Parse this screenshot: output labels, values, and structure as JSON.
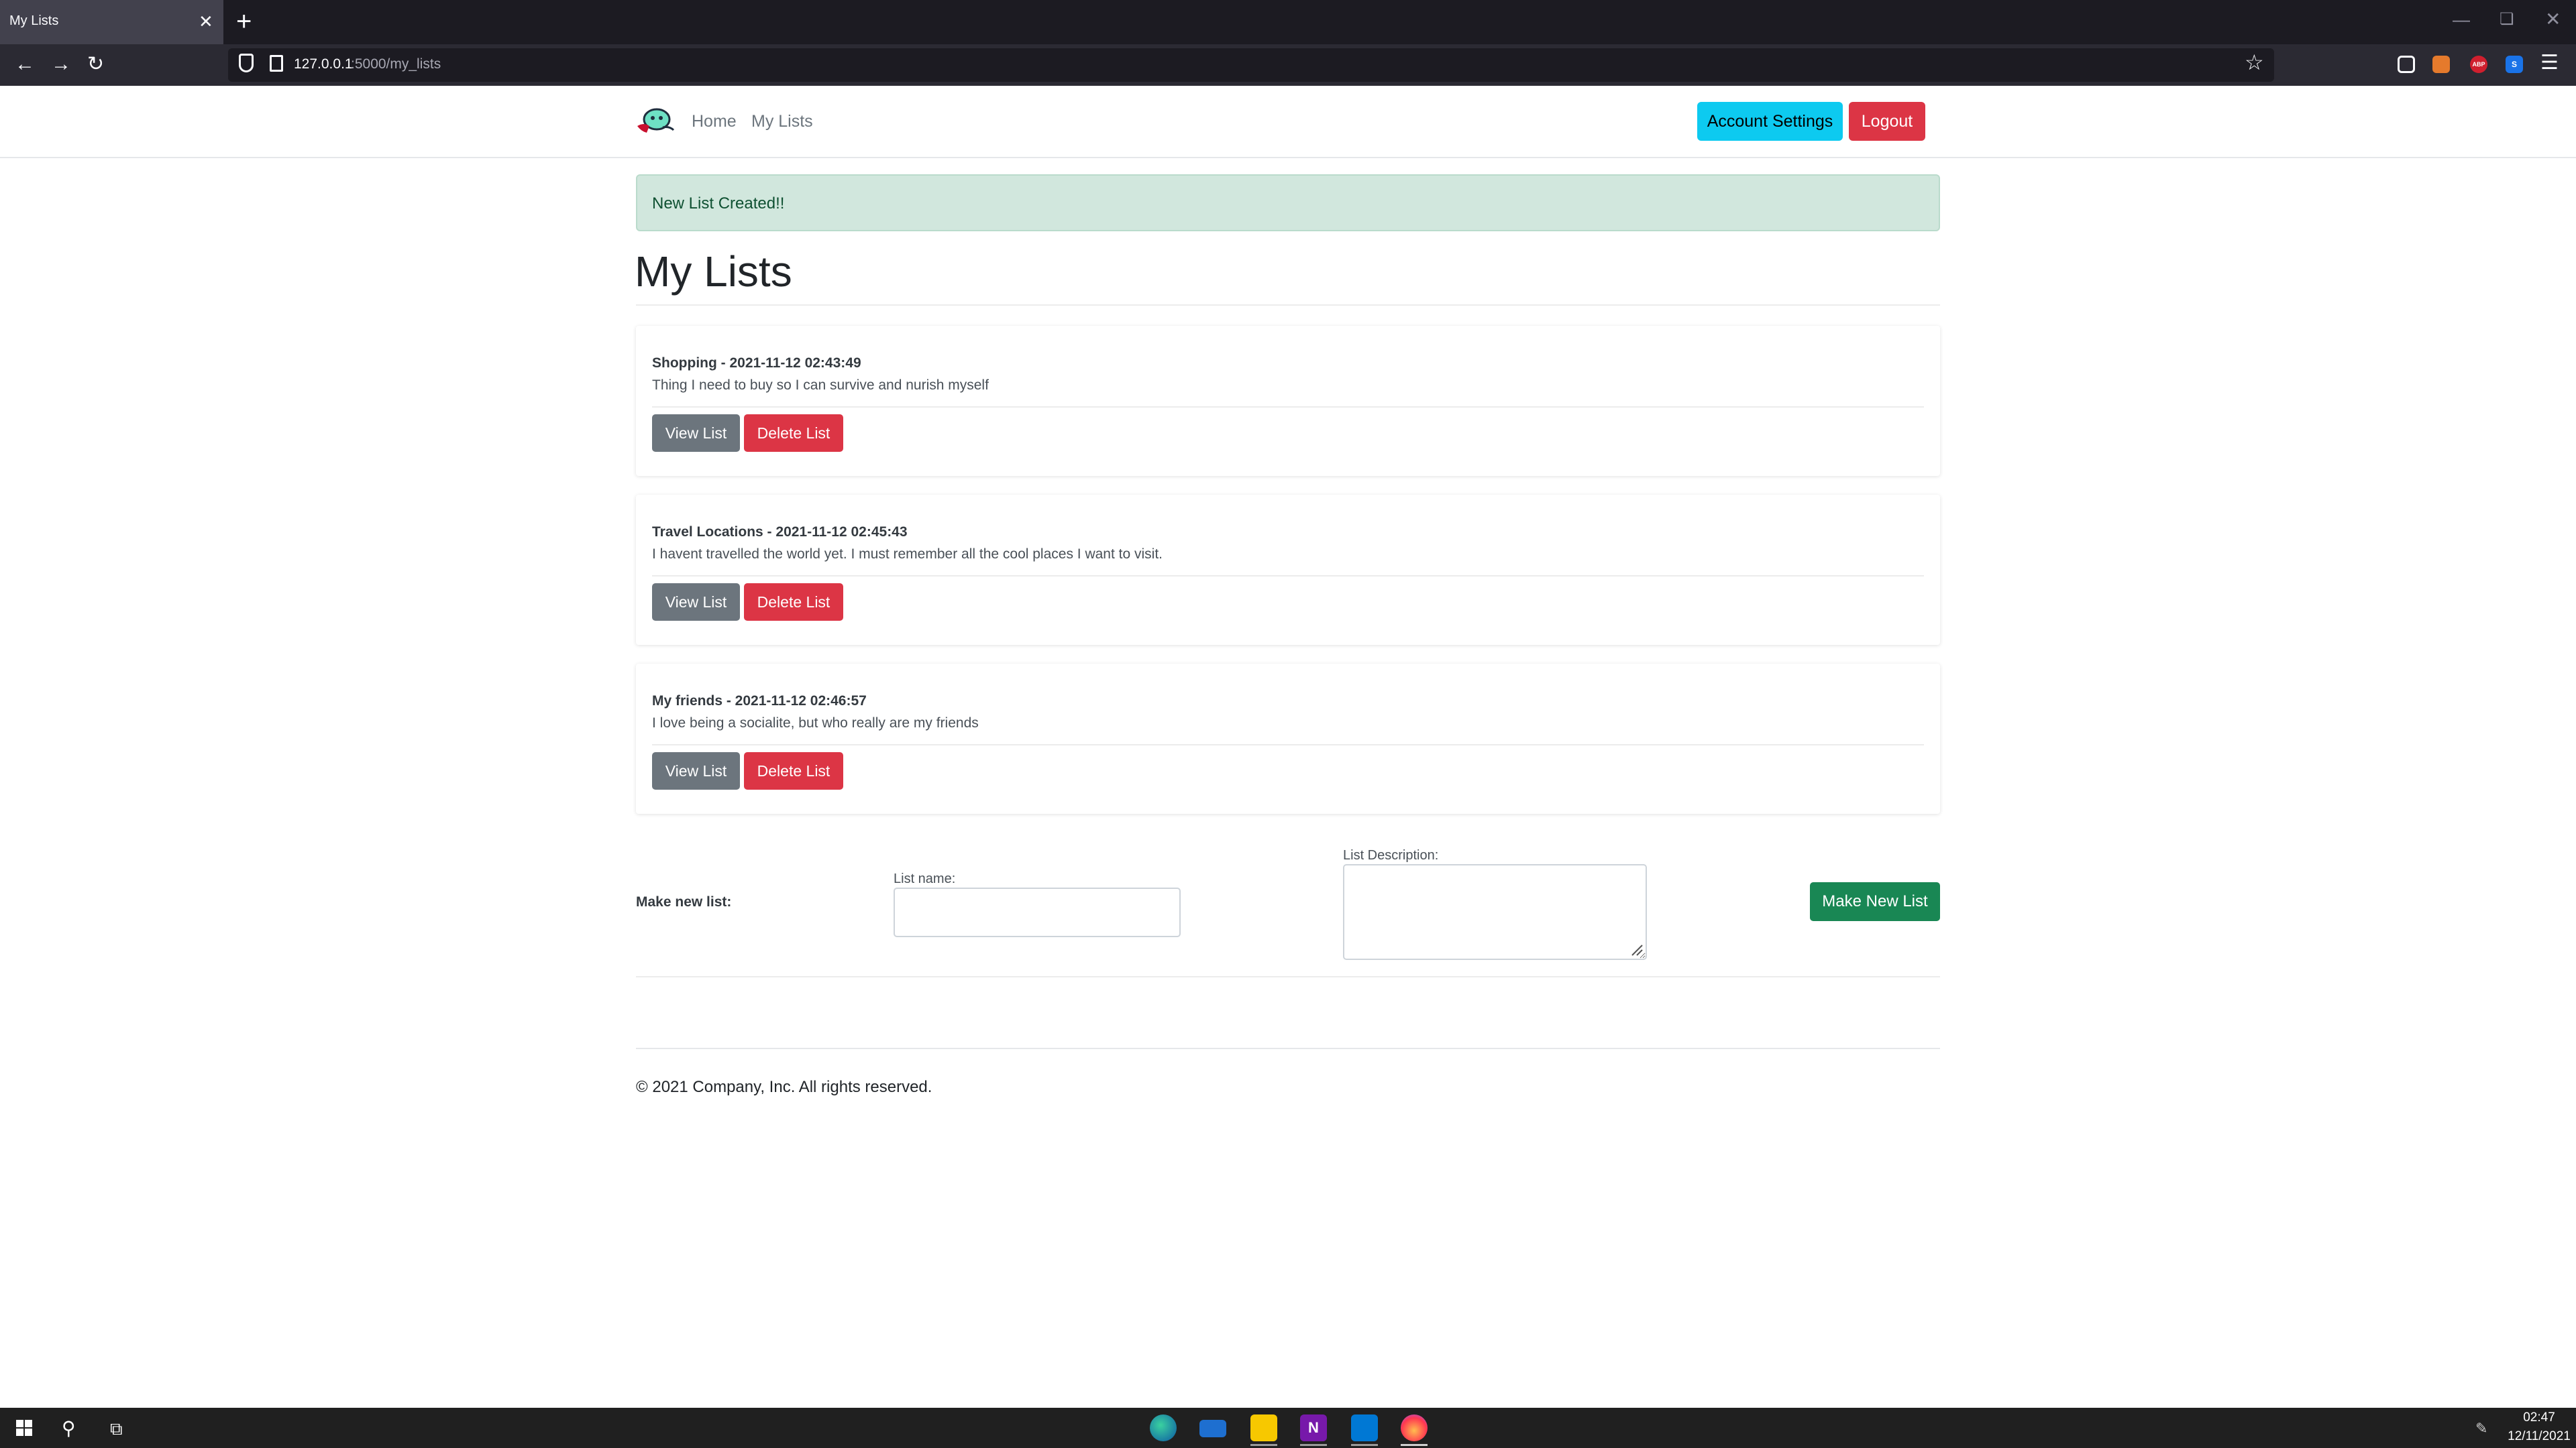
{
  "browser": {
    "tab_title": "My Lists",
    "tab_close": "✕",
    "new_tab": "+",
    "url_host": "127.0.0.1",
    "url_path": ":5000/my_lists",
    "icons": [
      "back-icon",
      "forward-icon",
      "reload-icon",
      "shield-icon",
      "page-icon",
      "star-icon",
      "pocket-icon",
      "fox-extension-icon",
      "adblock-icon",
      "s-extension-icon",
      "menu-icon"
    ],
    "ext_abp": "ABP",
    "ext_s": "S"
  },
  "header": {
    "nav_home": "Home",
    "nav_mylists": "My Lists",
    "account_button": "Account Settings",
    "logout_button": "Logout"
  },
  "alert": {
    "text": "New List Created!!",
    "color": "#d1e7dd"
  },
  "page_title": "My Lists",
  "lists": [
    {
      "title": "Shopping - 2021-11-12 02:43:49",
      "description": "Thing I need to buy so I can survive and nurish myself",
      "view_label": "View List",
      "delete_label": "Delete List"
    },
    {
      "title": "Travel Locations - 2021-11-12 02:45:43",
      "description": "I havent travelled the world yet. I must remember all the cool places I want to visit.",
      "view_label": "View List",
      "delete_label": "Delete List"
    },
    {
      "title": "My friends - 2021-11-12 02:46:57",
      "description": "I love being a socialite, but who really are my friends",
      "view_label": "View List",
      "delete_label": "Delete List"
    }
  ],
  "form": {
    "make_label": "Make new list:",
    "name_label": "List name:",
    "name_value": "",
    "desc_label": "List Description:",
    "desc_value": "",
    "submit_label": "Make New List"
  },
  "footer": {
    "text": "© 2021 Company, Inc. All rights reserved."
  },
  "taskbar": {
    "apps": [
      "edge-icon",
      "mail-icon",
      "sticky-notes-icon",
      "onenote-icon",
      "vscode-icon",
      "firefox-icon"
    ],
    "time": "02:47",
    "date": "12/11/2021"
  },
  "colors": {
    "info": "#0dcaf0",
    "danger": "#dc3545",
    "secondary": "#6c757d",
    "success": "#198754"
  }
}
